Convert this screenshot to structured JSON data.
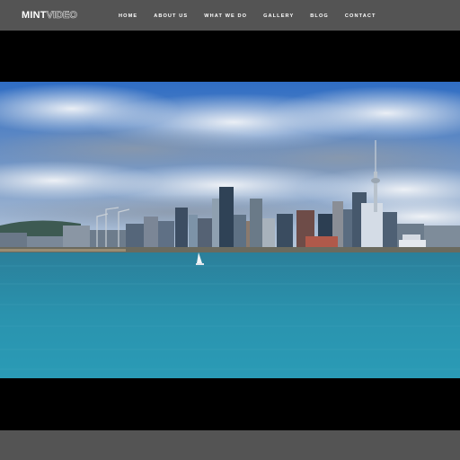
{
  "site": {
    "logo_primary": "MINT",
    "logo_secondary": "VIDEO"
  },
  "nav": {
    "items": [
      "HOME",
      "ABOUT US",
      "WHAT WE DO",
      "GALLERY",
      "BLOG",
      "CONTACT"
    ]
  },
  "colors": {
    "header_bg": "#545454",
    "video_bg": "#000000",
    "sky": "#3a74c4",
    "water": "#2a8ea8"
  },
  "media": {
    "scene": "city-skyline-harbor-image"
  }
}
